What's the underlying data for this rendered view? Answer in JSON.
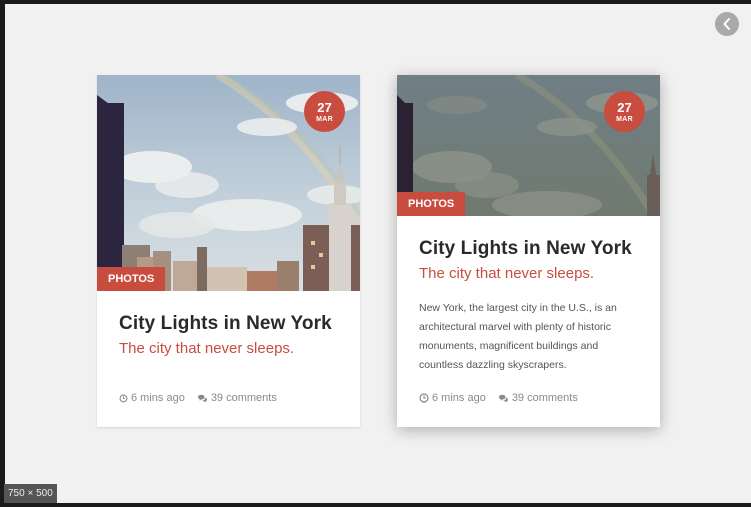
{
  "viewer": {
    "size_label": "750 × 500",
    "back_icon": "chevron-left-icon"
  },
  "colors": {
    "accent": "#c94d3f",
    "page_background": "#f1f1f1",
    "title_text": "#2a2a2a",
    "meta_text": "#8a8a8a"
  },
  "cards": [
    {
      "date_day": "27",
      "date_month": "MAR",
      "category": "PHOTOS",
      "title": "City Lights in New York",
      "subtitle": "The city that never sleeps.",
      "time_ago": "6 mins ago",
      "comments": "39 comments",
      "time_icon": "clock-icon",
      "comments_icon": "comments-icon"
    },
    {
      "date_day": "27",
      "date_month": "MAR",
      "category": "PHOTOS",
      "title": "City Lights in New York",
      "subtitle": "The city that never sleeps.",
      "body": "New York, the largest city in the U.S., is an architectural marvel with plenty of historic monuments, magnificent buildings and countless dazzling skyscrapers.",
      "time_ago": "6 mins ago",
      "comments": "39 comments",
      "time_icon": "clock-icon",
      "comments_icon": "comments-icon"
    }
  ]
}
